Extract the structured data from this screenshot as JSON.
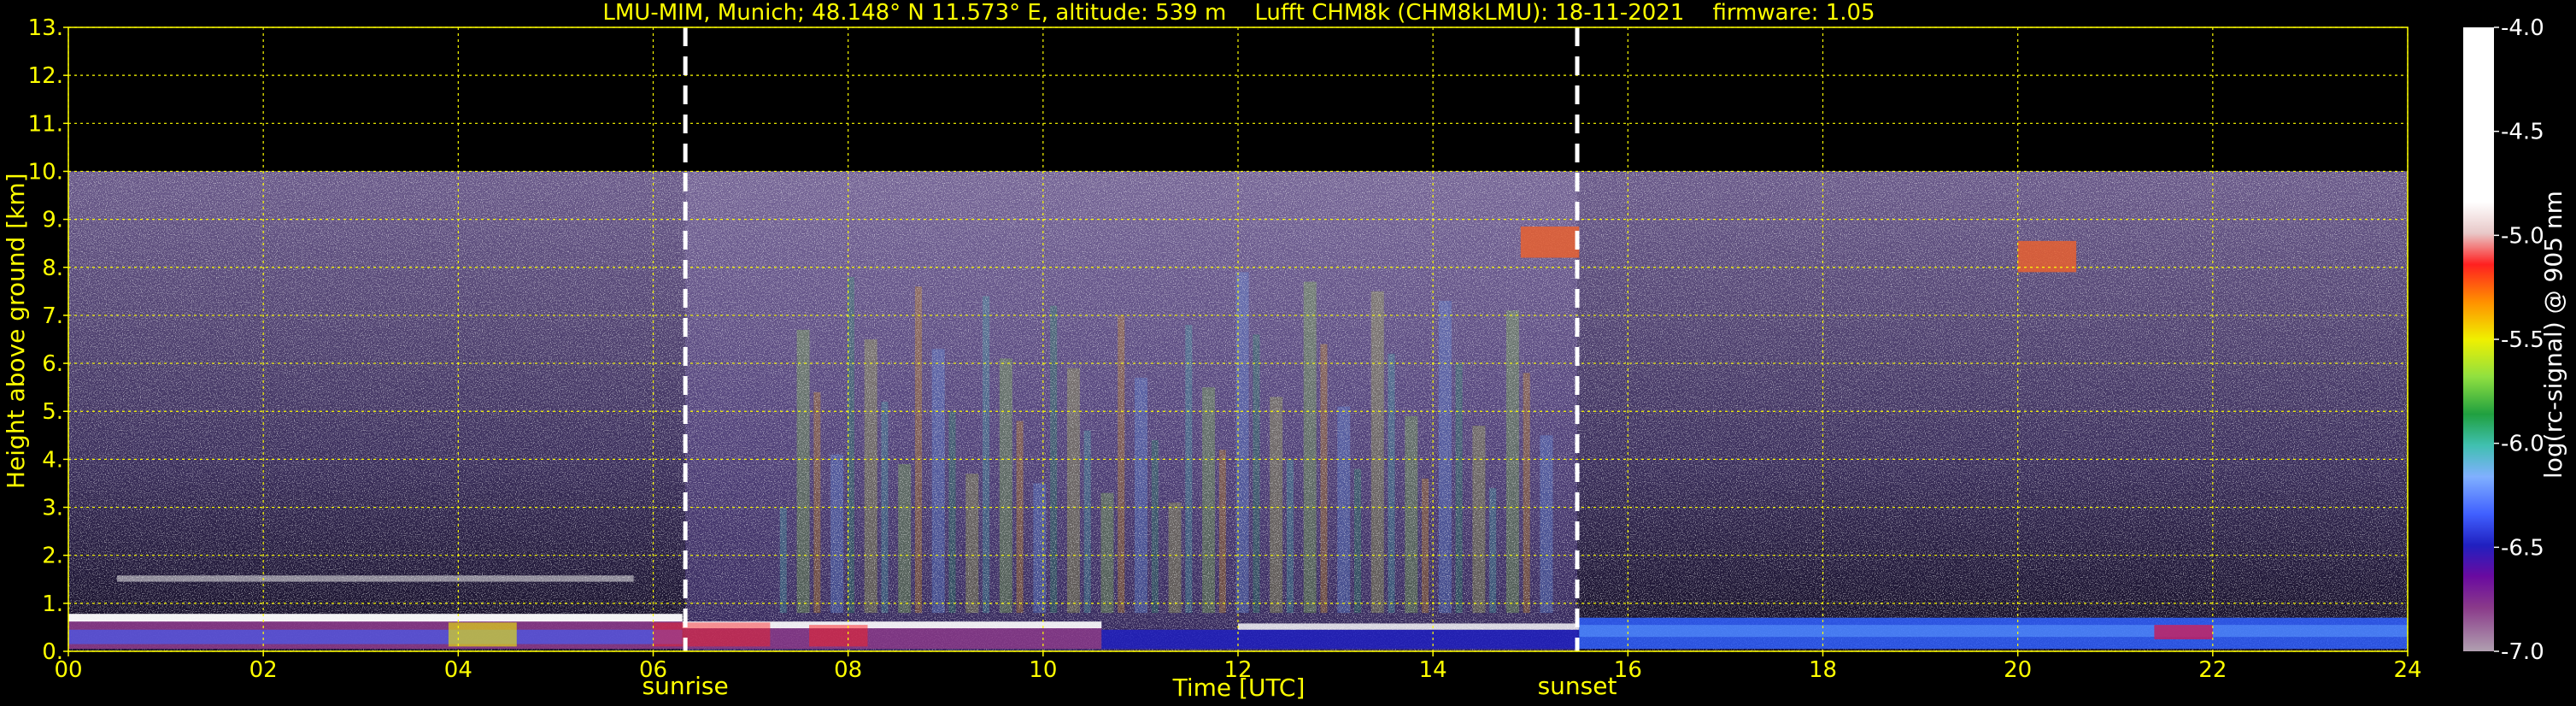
{
  "title": {
    "location": "LMU-MIM, Munich; 48.148° N 11.573° E, altitude: 539 m",
    "instrument": "Lufft CHM8k (CHM8kLMU): 18-11-2021",
    "firmware": "firmware: 1.05"
  },
  "events": [
    {
      "label": "sunrise",
      "time": 6.33
    },
    {
      "label": "sunset",
      "time": 15.48
    }
  ],
  "chart_data": {
    "type": "heatmap",
    "xlabel": "Time [UTC]",
    "ylabel": "Height above ground [km]",
    "xlim": [
      0,
      24
    ],
    "ylim": [
      0,
      13
    ],
    "x_ticks": [
      "00",
      "02",
      "04",
      "06",
      "08",
      "10",
      "12",
      "14",
      "16",
      "18",
      "20",
      "22",
      "24"
    ],
    "y_ticks": [
      "0.",
      "1.",
      "2.",
      "3.",
      "4.",
      "5.",
      "6.",
      "7.",
      "8.",
      "9.",
      "10.",
      "11.",
      "12.",
      "13."
    ],
    "grid": true,
    "data_ceiling_km": 10,
    "colorbar": {
      "label": "log(rc-signal) @ 905 nm",
      "range": [
        -7.0,
        -4.0
      ],
      "ticks": [
        "-4.0",
        "-4.5",
        "-5.0",
        "-5.5",
        "-6.0",
        "-6.5",
        "-7.0"
      ]
    },
    "features": [
      {
        "name": "boundary layer top (night)",
        "t_start": 0,
        "t_end": 6.3,
        "height_km": 0.7
      },
      {
        "name": "residual layer",
        "t_start": 0.5,
        "t_end": 5.8,
        "height_km": 1.5
      },
      {
        "name": "boundary layer top (day)",
        "t_start": 6.3,
        "t_end": 15.5,
        "height_km": 0.5
      },
      {
        "name": "cirrus",
        "t_start": 14.9,
        "t_end": 15.5,
        "height_km": 8.5
      },
      {
        "name": "cirrus",
        "t_start": 20.0,
        "t_end": 20.6,
        "height_km": 8.2
      }
    ]
  },
  "colors": {
    "text": "#ffff00",
    "grid": "#ffff00",
    "background": "#000000",
    "event_line": "#ffffff"
  }
}
